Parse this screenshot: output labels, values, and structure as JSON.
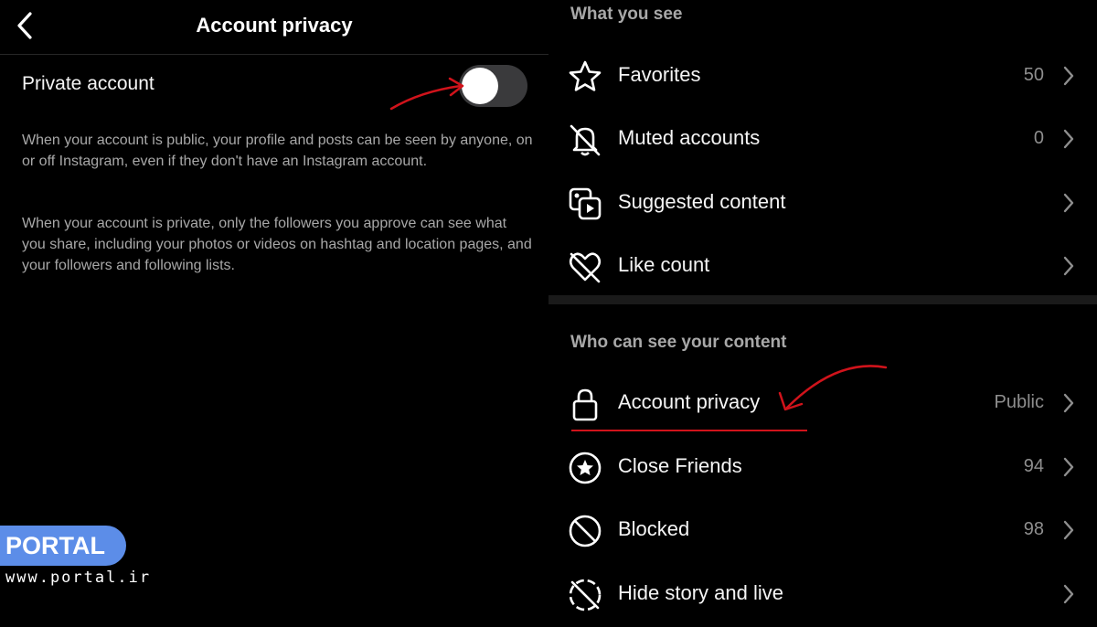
{
  "left_screen": {
    "title": "Account privacy",
    "back_icon": "chevron-left-icon",
    "private_account_label": "Private account",
    "private_toggle_on": false,
    "public_description": "When your account is public, your profile and posts can be seen by anyone, on or off Instagram, even if they don't have an Instagram account.",
    "private_description": "When your account is private, only the followers you approve can see what you share, including your photos or videos on hashtag and location pages, and your followers and following lists."
  },
  "right_screen": {
    "what_you_see": {
      "title": "What you see",
      "items": [
        {
          "label": "Favorites",
          "value": "50",
          "icon": "star-icon"
        },
        {
          "label": "Muted accounts",
          "value": "0",
          "icon": "bell-off-icon"
        },
        {
          "label": "Suggested content",
          "value": "",
          "icon": "media-play-icon"
        },
        {
          "label": "Like count",
          "value": "",
          "icon": "heart-off-icon"
        }
      ]
    },
    "who_can_see": {
      "title": "Who can see your content",
      "items": [
        {
          "label": "Account privacy",
          "value": "Public",
          "icon": "lock-icon"
        },
        {
          "label": "Close Friends",
          "value": "94",
          "icon": "star-circle-icon"
        },
        {
          "label": "Blocked",
          "value": "98",
          "icon": "blocked-icon"
        },
        {
          "label": "Hide story and live",
          "value": "",
          "icon": "story-off-icon"
        }
      ]
    }
  },
  "watermark": {
    "brand": "PORTAL",
    "url": "www.portal.ir"
  },
  "colors": {
    "background": "#000000",
    "secondary_text": "#a8a8a8",
    "annotation_red": "#d0131b",
    "badge_blue": "#5c8de8",
    "toggle_off": "#3a3a3c"
  }
}
